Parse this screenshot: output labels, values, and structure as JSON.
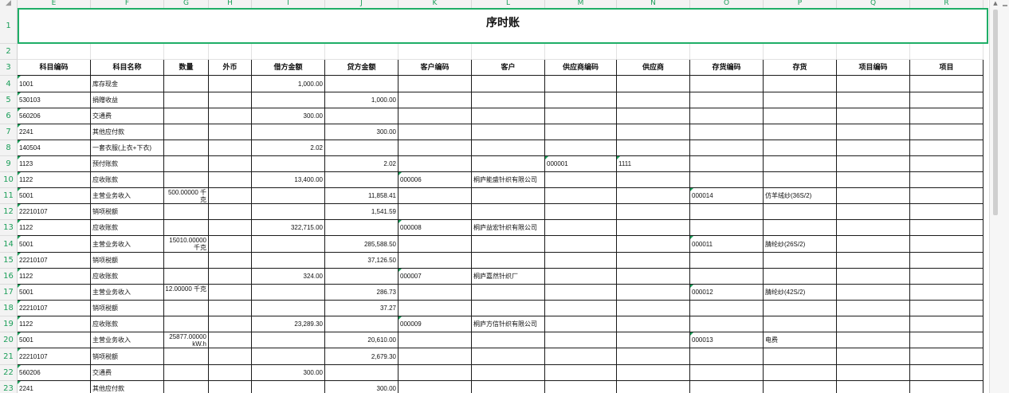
{
  "columns": [
    "E",
    "F",
    "G",
    "H",
    "I",
    "J",
    "K",
    "L",
    "M",
    "N",
    "O",
    "P",
    "Q",
    "R"
  ],
  "title": "序时账",
  "rows": [
    "1",
    "2",
    "3",
    "4",
    "5",
    "6",
    "7",
    "8",
    "9",
    "10",
    "11",
    "12",
    "13",
    "14",
    "15",
    "16",
    "17",
    "18",
    "19",
    "20",
    "21",
    "22",
    "23"
  ],
  "headers": [
    "科目编码",
    "科目名称",
    "数量",
    "外币",
    "借方金额",
    "贷方金额",
    "客户编码",
    "客户",
    "供应商编码",
    "供应商",
    "存货编码",
    "存货",
    "项目编码",
    "项目"
  ],
  "records": [
    [
      "1001",
      "库存现金",
      "",
      "",
      "1,000.00",
      "",
      "",
      "",
      "",
      "",
      "",
      "",
      "",
      ""
    ],
    [
      "530103",
      "捐赠收益",
      "",
      "",
      "",
      "1,000.00",
      "",
      "",
      "",
      "",
      "",
      "",
      "",
      ""
    ],
    [
      "560206",
      "交通费",
      "",
      "",
      "300.00",
      "",
      "",
      "",
      "",
      "",
      "",
      "",
      "",
      ""
    ],
    [
      "2241",
      "其他应付款",
      "",
      "",
      "",
      "300.00",
      "",
      "",
      "",
      "",
      "",
      "",
      "",
      ""
    ],
    [
      "140504",
      "一套衣服(上衣+下衣)",
      "",
      "",
      "2.02",
      "",
      "",
      "",
      "",
      "",
      "",
      "",
      "",
      ""
    ],
    [
      "1123",
      "预付账款",
      "",
      "",
      "",
      "2.02",
      "",
      "",
      "000001",
      "1111",
      "",
      "",
      "",
      ""
    ],
    [
      "1122",
      "应收账款",
      "",
      "",
      "13,400.00",
      "",
      "000006",
      "桐庐能盛针织有限公司",
      "",
      "",
      "",
      "",
      "",
      ""
    ],
    [
      "5001",
      "主营业务收入",
      "500.00000 千克",
      "",
      "",
      "11,858.41",
      "",
      "",
      "",
      "",
      "000014",
      "仿羊绒纱(36S/2)",
      "",
      ""
    ],
    [
      "22210107",
      "销项税额",
      "",
      "",
      "",
      "1,541.59",
      "",
      "",
      "",
      "",
      "",
      "",
      "",
      ""
    ],
    [
      "1122",
      "应收账款",
      "",
      "",
      "322,715.00",
      "",
      "000008",
      "桐庐益宏针织有限公司",
      "",
      "",
      "",
      "",
      "",
      ""
    ],
    [
      "5001",
      "主营业务收入",
      "15010.00000 千克",
      "",
      "",
      "285,588.50",
      "",
      "",
      "",
      "",
      "000011",
      "腈纶纱(26S/2)",
      "",
      ""
    ],
    [
      "22210107",
      "销项税额",
      "",
      "",
      "",
      "37,126.50",
      "",
      "",
      "",
      "",
      "",
      "",
      "",
      ""
    ],
    [
      "1122",
      "应收账款",
      "",
      "",
      "324.00",
      "",
      "000007",
      "桐庐嘉然针织厂",
      "",
      "",
      "",
      "",
      "",
      ""
    ],
    [
      "5001",
      "主营业务收入",
      "12.00000 千克",
      "",
      "",
      "286.73",
      "",
      "",
      "",
      "",
      "000012",
      "腈纶纱(42S/2)",
      "",
      ""
    ],
    [
      "22210107",
      "销项税额",
      "",
      "",
      "",
      "37.27",
      "",
      "",
      "",
      "",
      "",
      "",
      "",
      ""
    ],
    [
      "1122",
      "应收账款",
      "",
      "",
      "23,289.30",
      "",
      "000009",
      "桐庐方信针织有限公司",
      "",
      "",
      "",
      "",
      "",
      ""
    ],
    [
      "5001",
      "主营业务收入",
      "25877.00000 kW.h",
      "",
      "",
      "20,610.00",
      "",
      "",
      "",
      "",
      "000013",
      "电费",
      "",
      ""
    ],
    [
      "22210107",
      "销项税额",
      "",
      "",
      "",
      "2,679.30",
      "",
      "",
      "",
      "",
      "",
      "",
      "",
      ""
    ],
    [
      "560206",
      "交通费",
      "",
      "",
      "300.00",
      "",
      "",
      "",
      "",
      "",
      "",
      "",
      "",
      ""
    ],
    [
      "2241",
      "其他应付款",
      "",
      "",
      "",
      "300.00",
      "",
      "",
      "",
      "",
      "",
      "",
      "",
      ""
    ]
  ],
  "colors": {
    "accent": "#1b9e59",
    "title_border": "#1fae67"
  }
}
